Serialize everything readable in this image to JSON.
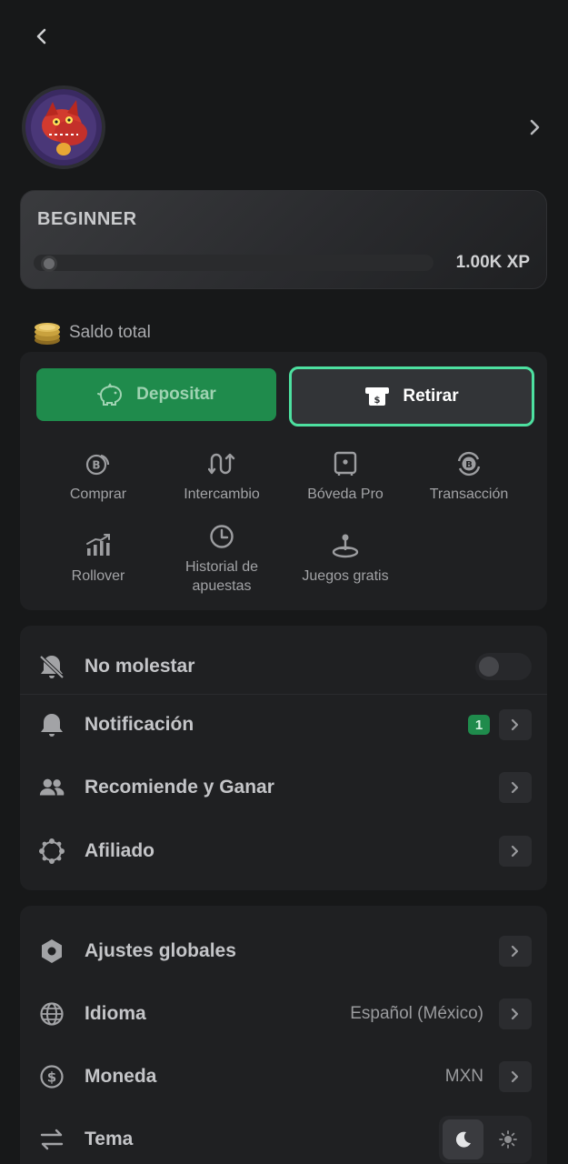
{
  "level": {
    "name": "BEGINNER",
    "xp_label": "1.00K XP",
    "progress": 0.0
  },
  "balance": {
    "label": "Saldo total"
  },
  "wallet": {
    "deposit_label": "Depositar",
    "withdraw_label": "Retirar",
    "actions": [
      {
        "label": "Comprar",
        "icon": "coin-bitcoin-icon"
      },
      {
        "label": "Intercambio",
        "icon": "swap-arrows-icon"
      },
      {
        "label": "Bóveda Pro",
        "icon": "vault-icon"
      },
      {
        "label": "Transacción",
        "icon": "transaction-icon"
      },
      {
        "label": "Rollover",
        "icon": "rollover-chart-icon"
      },
      {
        "label": "Historial de apuestas",
        "icon": "clock-icon"
      },
      {
        "label": "Juegos gratis",
        "icon": "joystick-icon"
      }
    ]
  },
  "menu1": {
    "dnd": "No molestar",
    "notification": "Notificación",
    "notification_count": "1",
    "refer": "Recomiende y Ganar",
    "affiliate": "Afiliado"
  },
  "menu2": {
    "global": "Ajustes globales",
    "language": "Idioma",
    "language_value": "Español (México)",
    "currency": "Moneda",
    "currency_value": "MXN",
    "theme": "Tema"
  },
  "colors": {
    "accent": "#1f8b4c",
    "highlight": "#4de0a0",
    "background": "#171819",
    "card": "#1f2022"
  }
}
